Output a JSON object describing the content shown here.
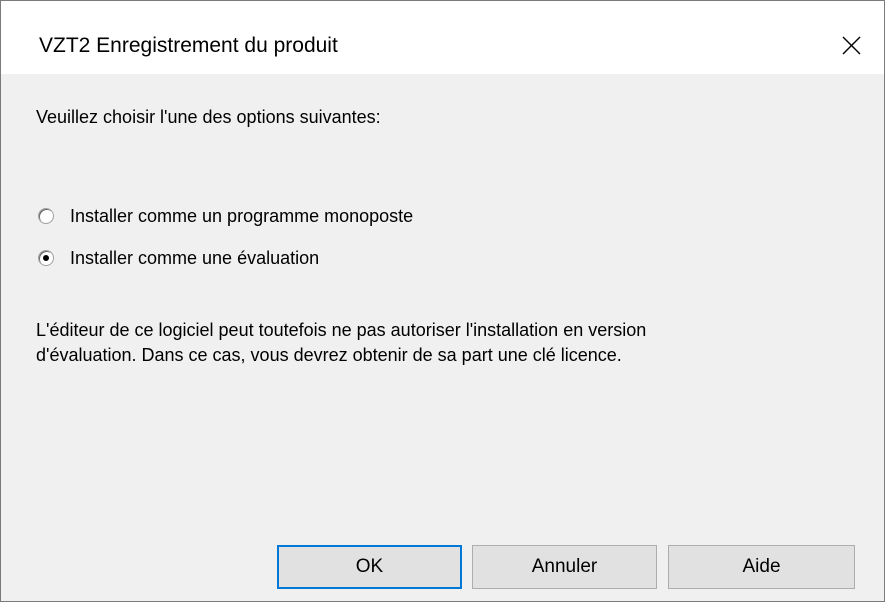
{
  "window": {
    "title": "VZT2 Enregistrement du produit",
    "close_label": "×"
  },
  "dialog": {
    "prompt": "Veuillez choisir l'une des options suivantes:",
    "options": [
      {
        "label": "Installer comme un programme monoposte",
        "checked": false
      },
      {
        "label": "Installer comme une évaluation",
        "checked": true
      }
    ],
    "note_line1": "L'éditeur de ce logiciel peut toutefois ne pas autoriser l'installation en version",
    "note_line2": "d'évaluation. Dans ce cas, vous devrez obtenir de sa part une clé licence."
  },
  "buttons": {
    "ok": "OK",
    "cancel": "Annuler",
    "help": "Aide"
  },
  "colors": {
    "background": "#f0f0f0",
    "titlebar": "#ffffff",
    "focus_border": "#0078d7",
    "button_face": "#e1e1e1"
  },
  "icons": {
    "close": "close-icon"
  }
}
